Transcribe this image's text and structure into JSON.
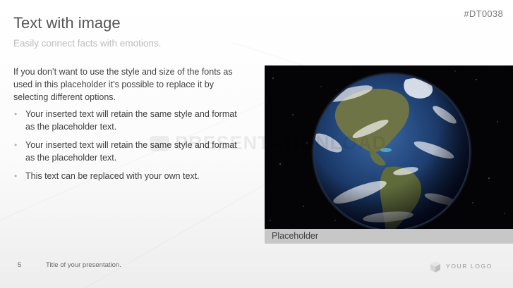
{
  "slide": {
    "code": "#DT0038",
    "title": "Text with image",
    "subtitle": "Easily connect facts with emotions.",
    "intro": "If you don’t want to use the style and size of the fonts as used in this placeholder it’s possible to replace it by selecting different options.",
    "bullets": [
      "Your inserted text will retain the same style and format as the placeholder text.",
      "Your inserted text will retain the same style and format as the placeholder text.",
      "This text can be replaced with your own text."
    ],
    "image_caption": "Placeholder",
    "watermark": "PRESENTATIONLOAD"
  },
  "footer": {
    "page_number": "5",
    "presentation_title": "Title of your presentation.",
    "logo_text": "YOUR LOGO"
  },
  "colors": {
    "title": "#555555",
    "subtitle": "#bdbdbd",
    "body_text": "#404040",
    "caption_bar": "#c7c7c7",
    "ocean": "#1d3d6e",
    "land": "#6f7446"
  },
  "icons": {
    "logo": "hexagon-logo-icon",
    "bullet": "bullet-dot-icon"
  }
}
